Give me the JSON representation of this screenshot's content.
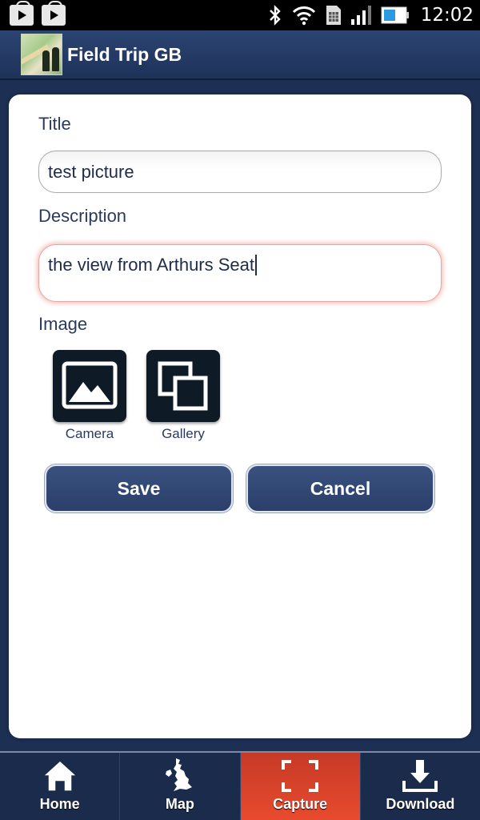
{
  "status_bar": {
    "time": "12:02",
    "icons": [
      "play-store-icon",
      "play-store-icon",
      "bluetooth-icon",
      "wifi-icon",
      "sim-icon",
      "signal-icon",
      "battery-icon"
    ]
  },
  "header": {
    "title": "Field Trip GB",
    "logo": "field-trip-logo"
  },
  "form": {
    "title_label": "Title",
    "title_value": "test picture",
    "description_label": "Description",
    "description_value": "the view from Arthurs Seat",
    "image_label": "Image",
    "image_buttons": [
      {
        "label": "Camera",
        "icon": "camera-image-icon"
      },
      {
        "label": "Gallery",
        "icon": "gallery-icon"
      }
    ],
    "save_label": "Save",
    "cancel_label": "Cancel"
  },
  "bottom_nav": {
    "items": [
      {
        "label": "Home",
        "icon": "home-icon"
      },
      {
        "label": "Map",
        "icon": "uk-map-icon"
      },
      {
        "label": "Capture",
        "icon": "capture-icon",
        "active": true
      },
      {
        "label": "Download",
        "icon": "download-icon"
      }
    ],
    "active_color": "#d9432a"
  },
  "colors": {
    "header_bg": "#253b66",
    "text": "#2a3a5e",
    "button_bg": "#2f4571"
  }
}
